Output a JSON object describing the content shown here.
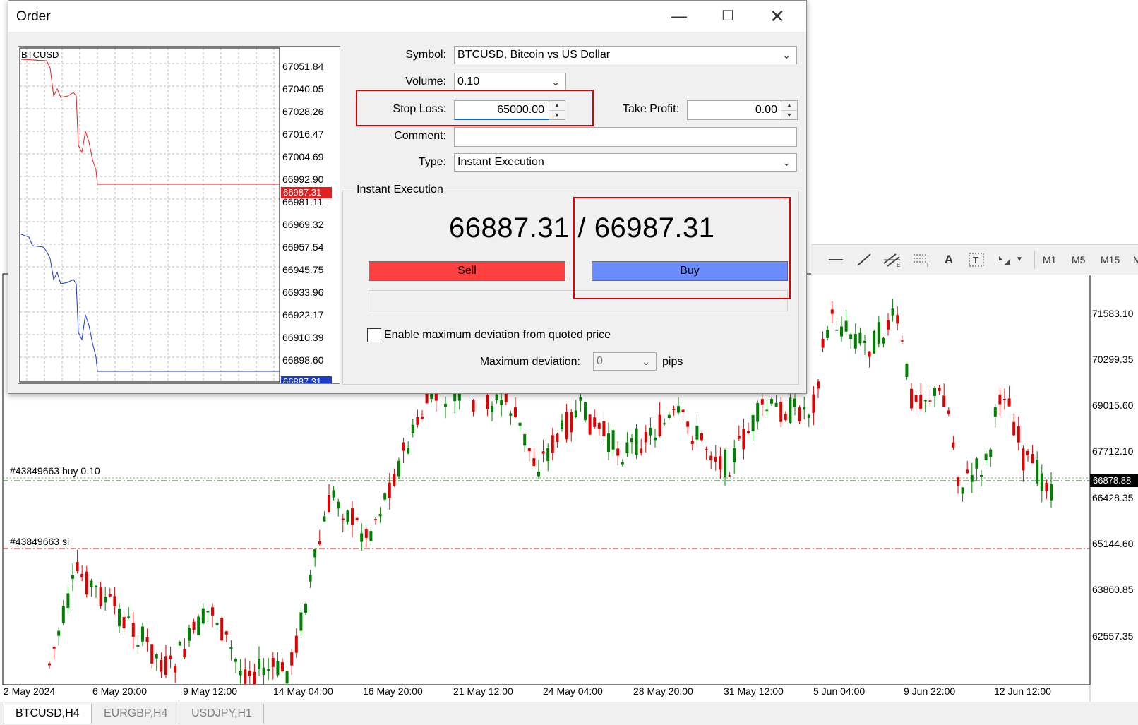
{
  "dialog": {
    "title": "Order",
    "symbol_label": "Symbol:",
    "symbol_value": "BTCUSD, Bitcoin vs US Dollar",
    "volume_label": "Volume:",
    "volume_value": "0.10",
    "stop_loss_label": "Stop Loss:",
    "stop_loss_value": "65000.00",
    "take_profit_label": "Take Profit:",
    "take_profit_value": "0.00",
    "comment_label": "Comment:",
    "comment_value": "",
    "type_label": "Type:",
    "type_value": "Instant Execution",
    "group_title": "Instant Execution",
    "bid": "66887.31",
    "ask": "66987.31",
    "sell_label": "Sell",
    "buy_label": "Buy",
    "deviation_checkbox_label": "Enable maximum deviation from quoted price",
    "max_deviation_label": "Maximum deviation:",
    "max_deviation_value": "0",
    "pips_label": "pips",
    "colors": {
      "sell": "#ff4040",
      "buy": "#6b8cff",
      "highlight": "#e00000"
    }
  },
  "mini_chart": {
    "symbol": "BTCUSD",
    "price_labels": [
      "67051.84",
      "67040.05",
      "67028.26",
      "67016.47",
      "67004.69",
      "66992.90",
      "66981.11",
      "66969.32",
      "66957.54",
      "66945.75",
      "66933.96",
      "66922.17",
      "66910.39",
      "66898.60"
    ],
    "ask_tag": "66987.31",
    "bid_tag": "66887.31",
    "ask_color": "#e02020",
    "bid_color": "#1c3cc8"
  },
  "toolbar": {
    "timeframes": [
      "M1",
      "M5",
      "M15",
      "M"
    ]
  },
  "main_chart": {
    "price_labels": [
      "71583.10",
      "70299.35",
      "69015.60",
      "67712.10",
      "66428.35",
      "65144.60",
      "63860.85",
      "62557.35"
    ],
    "current_price": "66878.88",
    "date_labels": [
      "2 May 2024",
      "6 May 20:00",
      "9 May 12:00",
      "14 May 04:00",
      "16 May 20:00",
      "21 May 12:00",
      "24 May 04:00",
      "28 May 20:00",
      "31 May 12:00",
      "5 Jun 04:00",
      "9 Jun 22:00",
      "12 Jun 12:00"
    ],
    "order_line_label": "#43849663 buy 0.10",
    "sl_line_label": "#43849663 sl",
    "bull_color": "#008000",
    "bear_color": "#e00000"
  },
  "tabs": [
    "BTCUSD,H4",
    "EURGBP,H4",
    "USDJPY,H1"
  ]
}
